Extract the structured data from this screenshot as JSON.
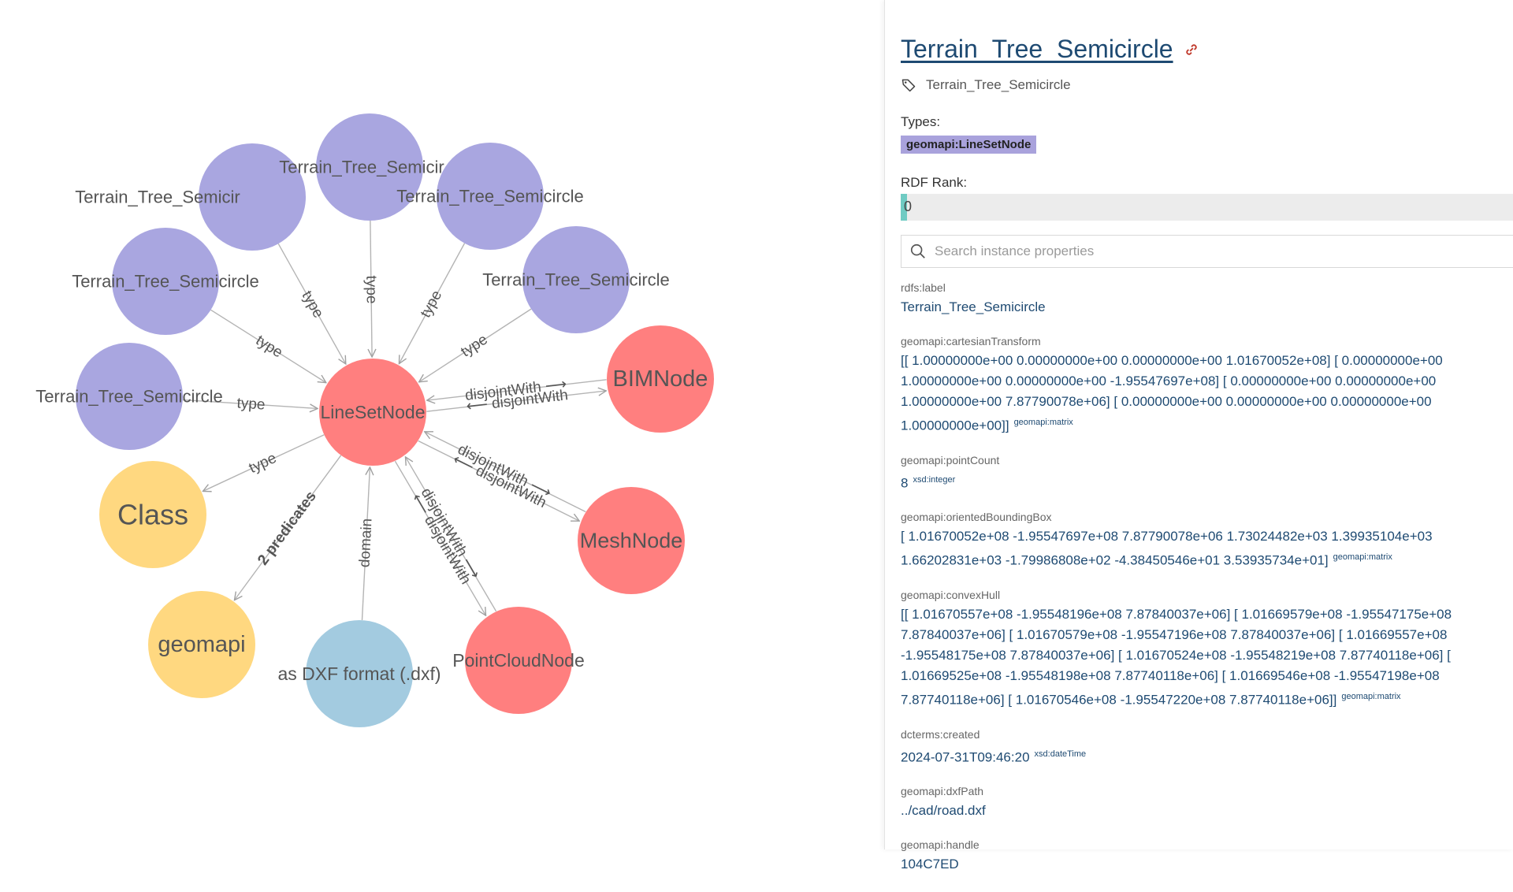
{
  "graph": {
    "nodes": [
      {
        "id": "t1",
        "label": "Terrain_Tree_Semicir",
        "color": "#a9a6e0"
      },
      {
        "id": "t2",
        "label": "Terrain_Tree_Semicir",
        "color": "#a9a6e0"
      },
      {
        "id": "t3",
        "label": "Terrain_Tree_Semicircle",
        "color": "#a9a6e0"
      },
      {
        "id": "t4",
        "label": "Terrain_Tree_Semicircle",
        "color": "#a9a6e0"
      },
      {
        "id": "t5",
        "label": "Terrain_Tree_Semicircle",
        "color": "#a9a6e0"
      },
      {
        "id": "t6",
        "label": "Terrain_Tree_Semicircle",
        "color": "#a9a6e0"
      },
      {
        "id": "center",
        "label": "LineSetNode",
        "color": "#ff7f7f"
      },
      {
        "id": "bim",
        "label": "BIMNode",
        "color": "#ff7f7f"
      },
      {
        "id": "mesh",
        "label": "MeshNode",
        "color": "#ff7f7f"
      },
      {
        "id": "pc",
        "label": "PointCloudNode",
        "color": "#ff7f7f"
      },
      {
        "id": "class",
        "label": "Class",
        "color": "#ffd880"
      },
      {
        "id": "geomapi",
        "label": "geomapi",
        "color": "#ffd880"
      },
      {
        "id": "dxf",
        "label": "as DXF format (.dxf)",
        "color": "#a3cbe0"
      }
    ],
    "edges": [
      {
        "id": "e1",
        "label": "type"
      },
      {
        "id": "e2",
        "label": "type"
      },
      {
        "id": "e3",
        "label": "type"
      },
      {
        "id": "e4",
        "label": "type"
      },
      {
        "id": "e5",
        "label": "type"
      },
      {
        "id": "e6",
        "label": "type"
      },
      {
        "id": "e7",
        "label": "type"
      },
      {
        "id": "e8",
        "label": "2 predicates"
      },
      {
        "id": "e9",
        "label": "domain"
      },
      {
        "id": "e10",
        "label": "disjointWith ⟶"
      },
      {
        "id": "e11",
        "label": "⟵ disjointWith"
      },
      {
        "id": "e12",
        "label": "disjointWith ⟶"
      },
      {
        "id": "e13",
        "label": "⟵ disjointWith"
      },
      {
        "id": "e14",
        "label": "disjointWith ⟶"
      },
      {
        "id": "e15",
        "label": "⟵ disjointWith"
      }
    ]
  },
  "panel": {
    "title": "Terrain_Tree_Semicircle",
    "label": "Terrain_Tree_Semicircle",
    "types_title": "Types:",
    "type_badge": "geomapi:LineSetNode",
    "rank_title": "RDF Rank:",
    "rank_value": "0",
    "rank_fraction": 0,
    "search_placeholder": "Search instance properties",
    "properties": [
      {
        "key": "rdfs:label",
        "value": "Terrain_Tree_Semicircle",
        "dtype": ""
      },
      {
        "key": "geomapi:cartesianTransform",
        "value": "[[ 1.00000000e+00 0.00000000e+00 0.00000000e+00 1.01670052e+08] [ 0.00000000e+00 1.00000000e+00 0.00000000e+00 -1.95547697e+08] [ 0.00000000e+00 0.00000000e+00 1.00000000e+00 7.87790078e+06] [ 0.00000000e+00 0.00000000e+00 0.00000000e+00 1.00000000e+00]]",
        "dtype": "geomapi:matrix"
      },
      {
        "key": "geomapi:pointCount",
        "value": "8",
        "dtype": "xsd:integer"
      },
      {
        "key": "geomapi:orientedBoundingBox",
        "value": "[ 1.01670052e+08 -1.95547697e+08 7.87790078e+06 1.73024482e+03 1.39935104e+03 1.66202831e+03 -1.79986808e+02 -4.38450546e+01 3.53935734e+01]",
        "dtype": "geomapi:matrix"
      },
      {
        "key": "geomapi:convexHull",
        "value": "[[ 1.01670557e+08 -1.95548196e+08 7.87840037e+06] [ 1.01669579e+08 -1.95547175e+08 7.87840037e+06] [ 1.01670579e+08 -1.95547196e+08 7.87840037e+06] [ 1.01669557e+08 -1.95548175e+08 7.87840037e+06] [ 1.01670524e+08 -1.95548219e+08 7.87740118e+06] [ 1.01669525e+08 -1.95548198e+08 7.87740118e+06] [ 1.01669546e+08 -1.95547198e+08 7.87740118e+06] [ 1.01670546e+08 -1.95547220e+08 7.87740118e+06]]",
        "dtype": "geomapi:matrix"
      },
      {
        "key": "dcterms:created",
        "value": "2024-07-31T09:46:20",
        "dtype": "xsd:dateTime"
      },
      {
        "key": "geomapi:dxfPath",
        "value": "../cad/road.dxf",
        "dtype": ""
      },
      {
        "key": "geomapi:handle",
        "value": "104C7ED",
        "dtype": ""
      }
    ]
  }
}
